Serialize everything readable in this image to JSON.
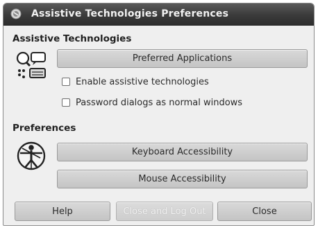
{
  "window": {
    "title": "Assistive Technologies Preferences"
  },
  "assistive": {
    "heading": "Assistive Technologies",
    "preferred_apps_label": "Preferred Applications",
    "enable_at_label": "Enable assistive technologies",
    "enable_at_checked": false,
    "password_dialogs_label": "Password dialogs as normal windows",
    "password_dialogs_checked": false,
    "icon": "assistive-technologies-icon"
  },
  "preferences": {
    "heading": "Preferences",
    "keyboard_label": "Keyboard Accessibility",
    "mouse_label": "Mouse Accessibility",
    "icon": "accessibility-person-icon"
  },
  "footer": {
    "help_label": "Help",
    "close_logout_label": "Close and Log Out",
    "close_logout_disabled": true,
    "close_label": "Close"
  }
}
